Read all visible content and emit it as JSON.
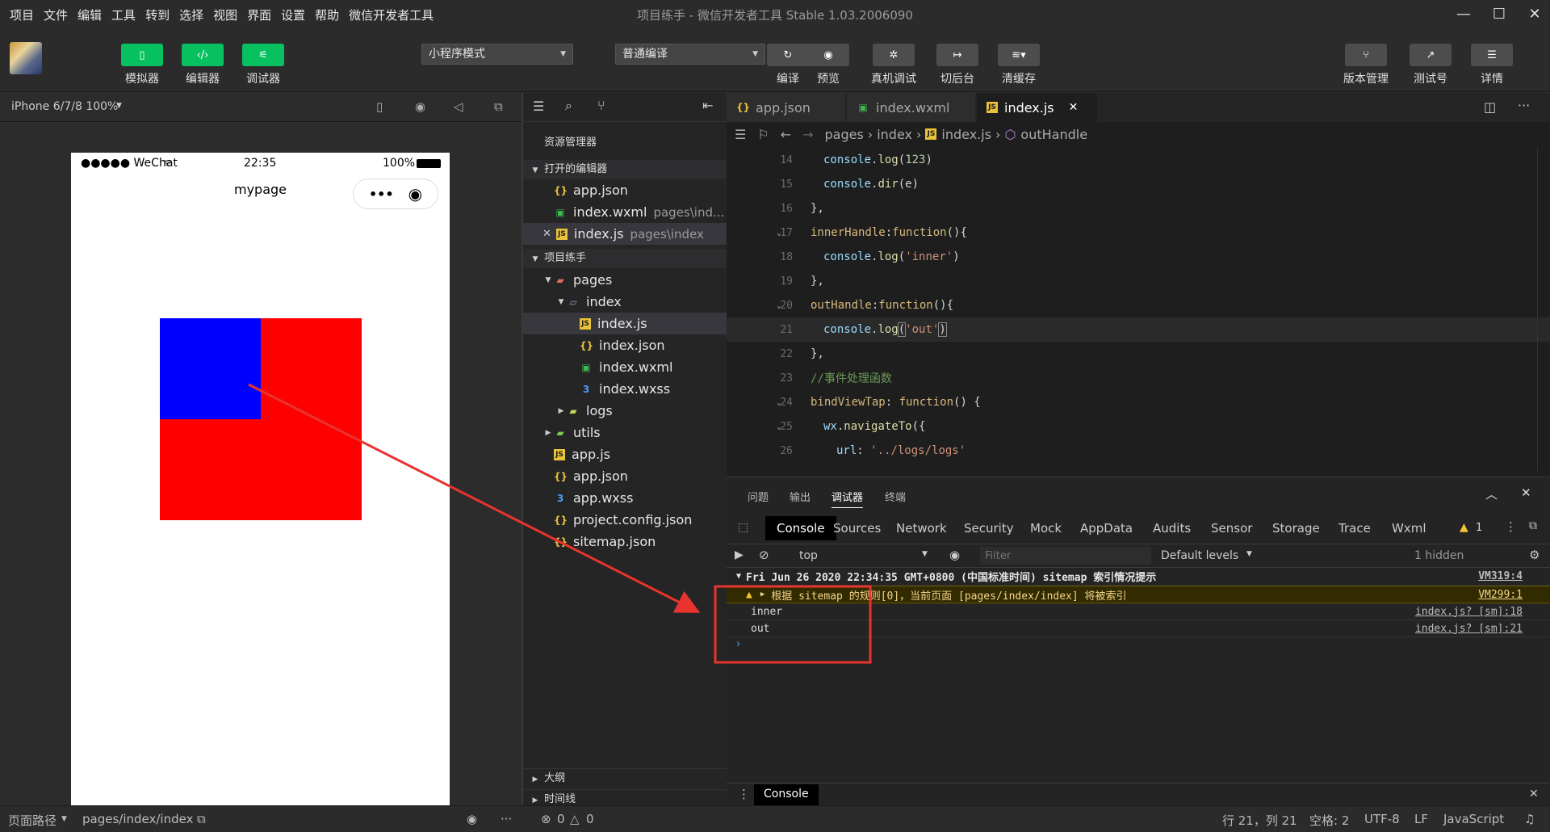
{
  "menu": [
    "项目",
    "文件",
    "编辑",
    "工具",
    "转到",
    "选择",
    "视图",
    "界面",
    "设置",
    "帮助",
    "微信开发者工具"
  ],
  "window_title": "项目练手 - 微信开发者工具 Stable 1.03.2006090",
  "toolbar": {
    "simulator": "模拟器",
    "editor": "编辑器",
    "debugger": "调试器",
    "mode_select": "小程序模式",
    "compile_select": "普通编译",
    "compile": "编译",
    "preview": "预览",
    "real_debug": "真机调试",
    "background": "切后台",
    "clear_cache": "清缓存",
    "version": "版本管理",
    "test_account": "测试号",
    "details": "详情"
  },
  "simulator": {
    "device": "iPhone 6/7/8 100%",
    "status_carrier": "●●●●● WeChat",
    "status_time": "22:35",
    "status_battery": "100%",
    "page_title": "mypage"
  },
  "explorer": {
    "title": "资源管理器",
    "open_editors": "打开的编辑器",
    "open_files": [
      {
        "name": "app.json",
        "path": ""
      },
      {
        "name": "index.wxml",
        "path": "pages\\ind..."
      },
      {
        "name": "index.js",
        "path": "pages\\index"
      }
    ],
    "project": "项目练手",
    "tree": {
      "pages": "pages",
      "index": "index",
      "index_js": "index.js",
      "index_json": "index.json",
      "index_wxml": "index.wxml",
      "index_wxss": "index.wxss",
      "logs": "logs",
      "utils": "utils",
      "app_js": "app.js",
      "app_json": "app.json",
      "app_wxss": "app.wxss",
      "project_config": "project.config.json",
      "sitemap": "sitemap.json"
    },
    "outline": "大纲",
    "timeline": "时间线"
  },
  "tabs": [
    "app.json",
    "index.wxml",
    "index.js"
  ],
  "breadcrumb": {
    "p1": "pages",
    "p2": "index",
    "p3": "index.js",
    "p4": "outHandle"
  },
  "code_lines": [
    "14",
    "15",
    "16",
    "17",
    "18",
    "19",
    "20",
    "21",
    "22",
    "23",
    "24",
    "25",
    "26"
  ],
  "panel": {
    "tabs": [
      "问题",
      "输出",
      "调试器",
      "终端"
    ],
    "devtools": [
      "Console",
      "Sources",
      "Network",
      "Security",
      "Mock",
      "AppData",
      "Audits",
      "Sensor",
      "Storage",
      "Trace",
      "Wxml"
    ],
    "warn_count": "1",
    "context": "top",
    "filter_placeholder": "Filter",
    "levels": "Default levels",
    "hidden": "1 hidden",
    "group_header": "Fri Jun 26 2020 22:34:35 GMT+0800 (中国标准时间) sitemap 索引情况提示",
    "group_src": "VM319:4",
    "warn_text": "根据 sitemap 的规则[0]，当前页面 [pages/index/index] 将被索引",
    "warn_src": "VM299:1",
    "log1": "inner",
    "log1_src": "index.js? [sm]:18",
    "log2": "out",
    "log2_src": "index.js? [sm]:21",
    "drawer_tab": "Console"
  },
  "status": {
    "path_label": "页面路径",
    "path": "pages/index/index",
    "errors": "0",
    "warnings": "0",
    "cursor": "行 21，列 21",
    "indent": "空格: 2",
    "encoding": "UTF-8",
    "eol": "LF",
    "language": "JavaScript"
  },
  "colors": {
    "green": "#07c160",
    "red_box": "#ff0000",
    "blue_box": "#0000ff",
    "annotation": "#e8332e"
  }
}
